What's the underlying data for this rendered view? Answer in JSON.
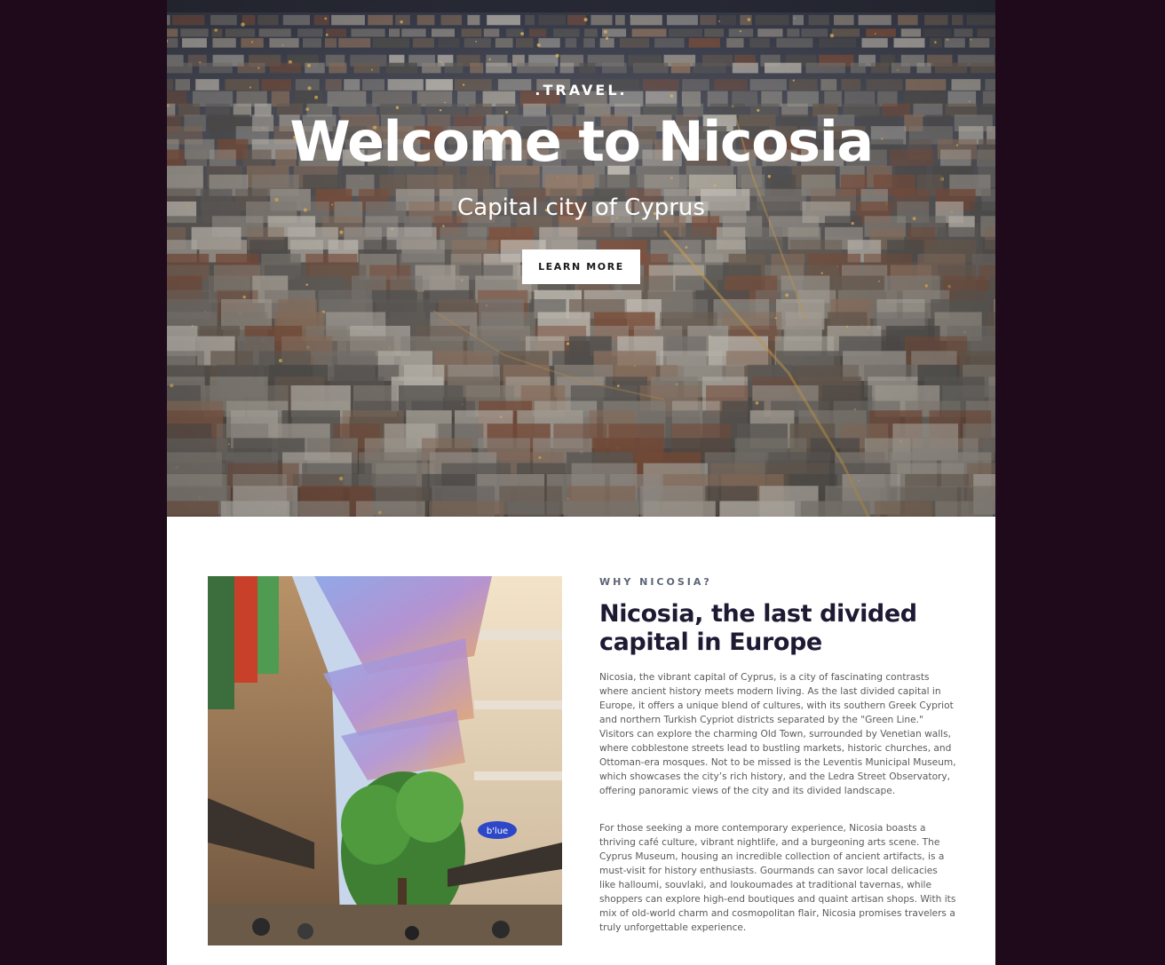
{
  "hero": {
    "eyebrow": ".TRAVEL.",
    "title": "Welcome to Nicosia",
    "subtitle": "Capital city of Cyprus",
    "button_label": "LEARN MORE"
  },
  "about": {
    "eyebrow": "WHY NICOSIA?",
    "heading": "Nicosia, the last divided capital in Europe",
    "paragraphs": [
      "Nicosia, the vibrant capital of Cyprus, is a city of fascinating contrasts where ancient history meets modern living. As the last divided capital in Europe, it offers a unique blend of cultures, with its southern Greek Cypriot and northern Turkish Cypriot districts separated by the \"Green Line.\" Visitors can explore the charming Old Town, surrounded by Venetian walls, where cobblestone streets lead to bustling markets, historic churches, and Ottoman-era mosques. Not to be missed is the Leventis Municipal Museum, which showcases the city’s rich history, and the Ledra Street Observatory, offering panoramic views of the city and its divided landscape.",
      "For those seeking a more contemporary experience, Nicosia boasts a thriving café culture, vibrant nightlife, and a burgeoning arts scene. The Cyprus Museum, housing an incredible collection of ancient artifacts, is a must-visit for history enthusiasts. Gourmands can savor local delicacies like halloumi, souvlaki, and loukoumades at traditional tavernas, while shoppers can explore high-end boutiques and quaint artisan shops. With its mix of old-world charm and cosmopolitan flair, Nicosia promises travelers a truly unforgettable experience."
    ],
    "image_sign_text": "b'lue"
  },
  "colors": {
    "page_background": "#1f0a1c",
    "content_background": "#ffffff",
    "heading": "#1e1a33",
    "eyebrow": "#5c6477",
    "body_text": "#5a5a5a"
  }
}
